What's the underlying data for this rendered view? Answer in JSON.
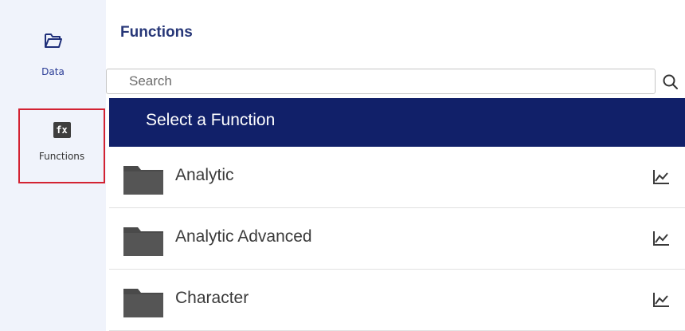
{
  "sidebar": {
    "items": [
      {
        "label": "Data",
        "icon": "folder-open-icon"
      },
      {
        "label": "Functions",
        "icon": "fx-icon",
        "icon_text": "fx",
        "selected": true
      }
    ]
  },
  "panel": {
    "title": "Functions",
    "search": {
      "placeholder": "Search",
      "value": ""
    },
    "header": "Select a Function",
    "rows": [
      {
        "label": "Analytic",
        "icon": "folder-icon",
        "action_icon": "chart-icon"
      },
      {
        "label": "Analytic Advanced",
        "icon": "folder-icon",
        "action_icon": "chart-icon"
      },
      {
        "label": "Character",
        "icon": "folder-icon",
        "action_icon": "chart-icon"
      }
    ]
  },
  "colors": {
    "sidebar_bg": "#f0f3fb",
    "header_bg": "#112069",
    "title": "#273778",
    "highlight_border": "#d32232",
    "folder": "#4a4a4a"
  }
}
